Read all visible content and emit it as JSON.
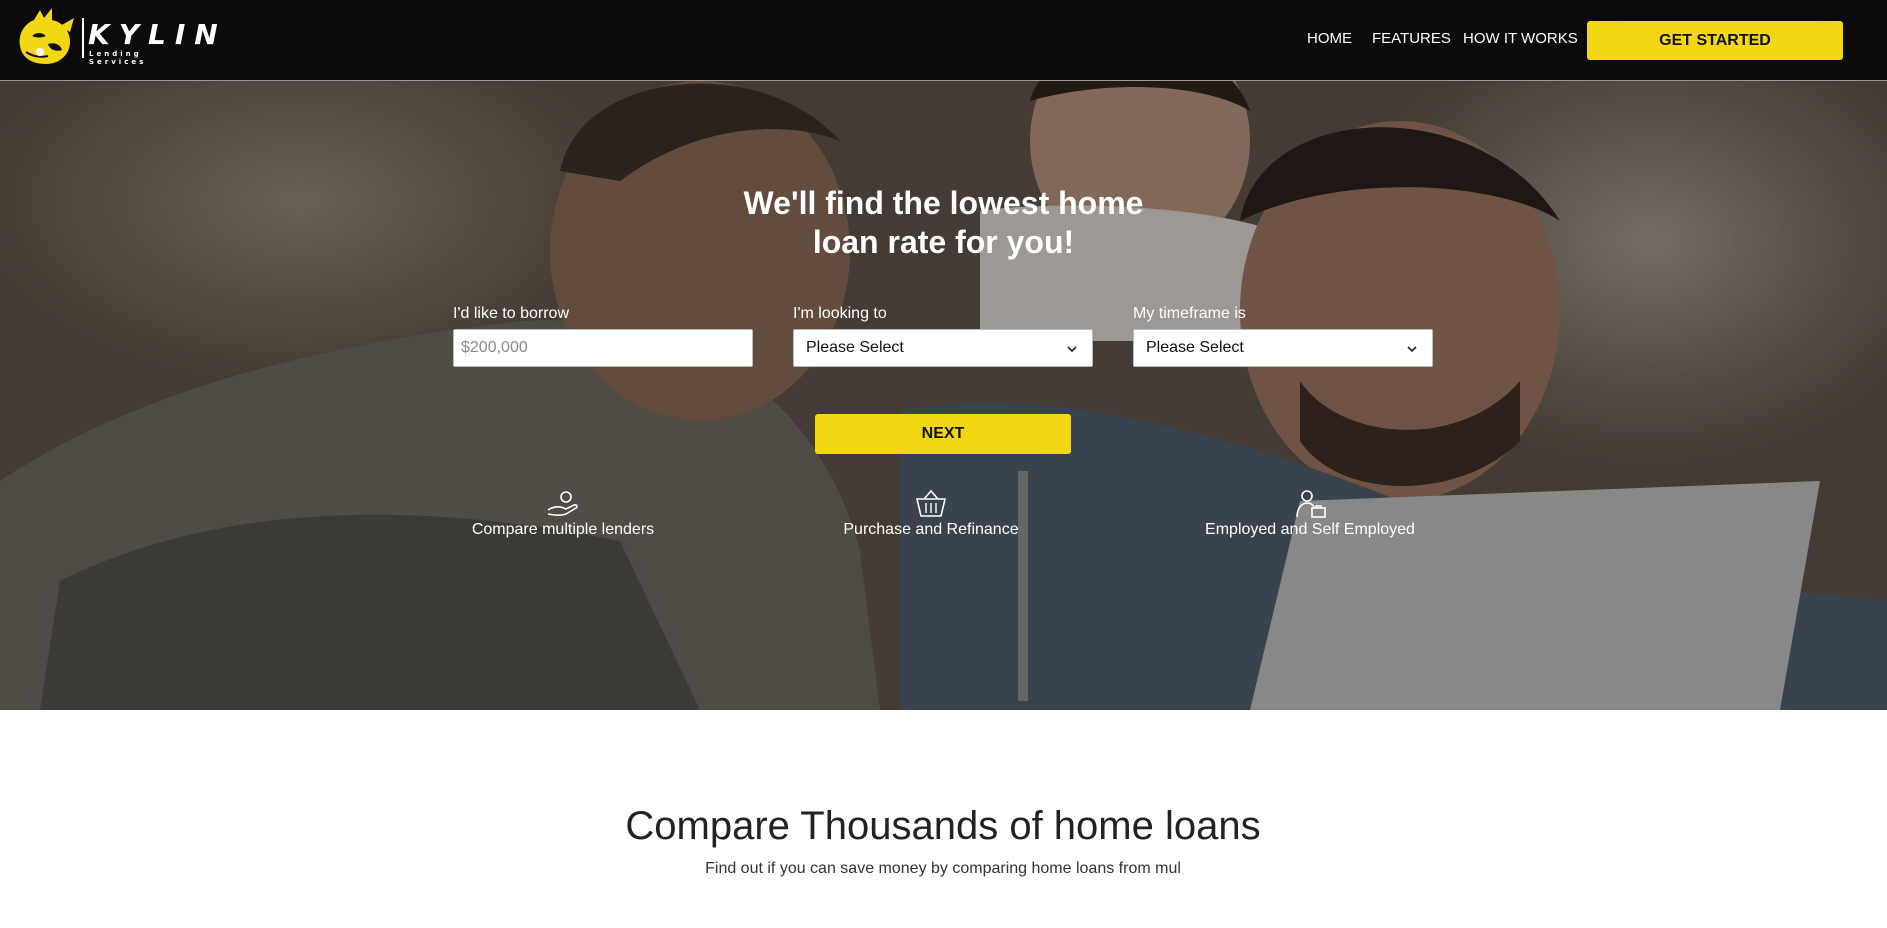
{
  "brand": {
    "name": "KYLIN",
    "tagline": "Lending Services",
    "accent_color": "#f4d713",
    "nav_bg": "#0b0b0b"
  },
  "nav": {
    "links": [
      {
        "label": "HOME"
      },
      {
        "label": "FEATURES"
      },
      {
        "label": "HOW IT WORKS"
      }
    ],
    "cta": "GET STARTED"
  },
  "hero": {
    "title_line1": "We'll find the lowest home",
    "title_line2": "loan rate for you!",
    "form": {
      "borrow": {
        "label": "I'd like to borrow",
        "placeholder": "$200,000",
        "value": ""
      },
      "looking": {
        "label": "I'm looking to",
        "selected": "Please Select"
      },
      "timeframe": {
        "label": "My timeframe is",
        "selected": "Please Select"
      }
    },
    "next_button": "NEXT",
    "features": [
      {
        "icon": "hand-coin-icon",
        "label": "Compare multiple lenders"
      },
      {
        "icon": "basket-icon",
        "label": "Purchase and Refinance"
      },
      {
        "icon": "worker-briefcase-icon",
        "label": "Employed and Self Employed"
      }
    ]
  },
  "section": {
    "title": "Compare Thousands of home loans",
    "subtitle": "Find out if you can save money by comparing home loans from mul"
  }
}
